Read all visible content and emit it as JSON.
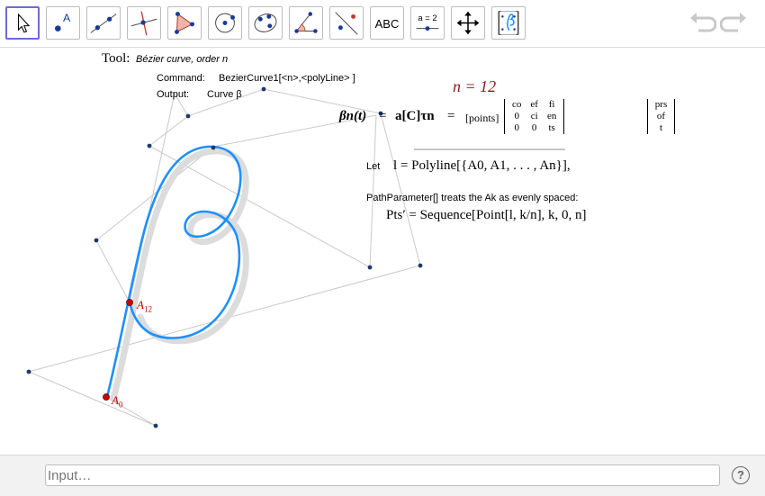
{
  "toolbar": {
    "tools": [
      "move",
      "point",
      "line",
      "perpendicular-line",
      "polygon",
      "circle",
      "conic",
      "angle",
      "reflect",
      "text",
      "slider",
      "move-graphics-view",
      "custom-tool"
    ],
    "text_tool_label": "ABC",
    "slider_label": "a = 2"
  },
  "tool_info": {
    "tool_label": "Tool:",
    "tool_name": "Bézier curve, order n",
    "command_label": "Command:",
    "command_value": "BezierCurve1[<n>,<polyLine> ]",
    "output_label": "Output:",
    "output_value": "Curve β"
  },
  "formulas": {
    "n_eq": "n = 12",
    "beta_lhs": "βn(t)",
    "equals": "=",
    "rhs_vec": "a[C]τn",
    "points_label": "[points]",
    "matrix": [
      [
        "co",
        "ef",
        "fi"
      ],
      [
        "0",
        "ci",
        "en"
      ],
      [
        "0",
        "0",
        "ts"
      ]
    ],
    "vector": [
      "prs",
      "of",
      "t"
    ],
    "separator": "_______________________________",
    "let_label": "Let",
    "let_formula": "l = Polyline[{A0, A1, . . . , An}],",
    "path_note": "PathParameter[] treats the Ak as evenly spaced:",
    "pts_formula": "Pts′ = Sequence[Point[l, k/n], k, 0, n]"
  },
  "points": {
    "a0_label": "A0",
    "a12_label": "A12"
  },
  "input_bar": {
    "placeholder": "Input…",
    "help": "?"
  },
  "colors": {
    "curve": "#1e90ff",
    "shadow": "#d8d8d8",
    "point_red": "#cc0000",
    "point_navy": "#1a3a6a",
    "formula_red": "#8b1a1a",
    "active_border": "#6b6bd6"
  }
}
